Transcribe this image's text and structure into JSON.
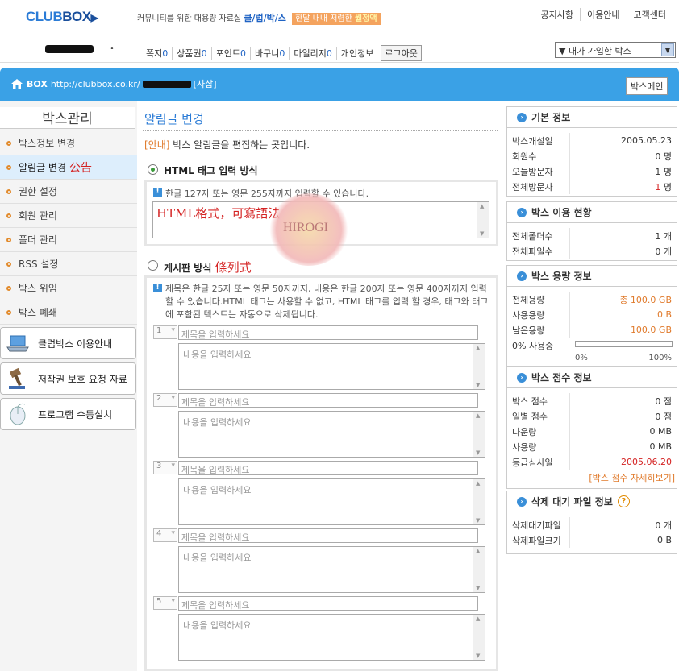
{
  "header": {
    "logo_main": "CLUB",
    "logo_box": "BOX",
    "tagline": "커뮤니티를 위한 대용량 자료실",
    "tagline_brand": "클/럽/박/스",
    "tagline_badge_prefix": "한달 내내 저렴한",
    "tagline_badge_emph": "월정액",
    "links": [
      "공지사항",
      "이용안내",
      "고객센터"
    ]
  },
  "userbar": {
    "items": [
      {
        "label": "쪽지",
        "count": "0"
      },
      {
        "label": "상품권",
        "count": "0"
      },
      {
        "label": "포인트",
        "count": "0"
      },
      {
        "label": "바구니",
        "count": "0"
      },
      {
        "label": "마일리지",
        "count": "0"
      },
      {
        "label": "개인정보",
        "count": ""
      }
    ],
    "logout": "로그아웃",
    "box_select": "▼ 내가 가입한 박스"
  },
  "band": {
    "box_label": "BOX",
    "url": "http://clubbox.co.kr/",
    "tag": "[사삽]",
    "box_main_button": "박스메인"
  },
  "sidebar": {
    "title": "박스관리",
    "items": [
      {
        "label": "박스정보 변경",
        "note": ""
      },
      {
        "label": "알림글 변경",
        "note": "公告"
      },
      {
        "label": "권한 설정",
        "note": ""
      },
      {
        "label": "회원 관리",
        "note": ""
      },
      {
        "label": "폴더 관리",
        "note": ""
      },
      {
        "label": "RSS 설정",
        "note": ""
      },
      {
        "label": "박스 위임",
        "note": ""
      },
      {
        "label": "박스 폐쇄",
        "note": ""
      }
    ],
    "buttons": [
      {
        "label": "클럽박스 이용안내",
        "icon": "laptop-icon"
      },
      {
        "label": "저작권 보호 요청 자료",
        "icon": "gavel-icon"
      },
      {
        "label": "프로그램 수동설치",
        "icon": "mouse-icon"
      }
    ]
  },
  "main": {
    "title": "알림글 변경",
    "notice_tag": "[안내]",
    "notice_text": "박스 알림글을 편집하는 곳입니다.",
    "html_mode": {
      "label": "HTML 태그 입력 방식",
      "info": "한글 127자 또는 영문 255자까지 입력할 수 있습니다.",
      "textarea_value": "HTML格式，可寫語法"
    },
    "board_mode": {
      "label": "게시판 방식",
      "note": "條列式",
      "info": "제목은 한글 25자 또는 영문 50자까지, 내용은 한글 200자 또는 영문 400자까지 입력할 수 있습니다.HTML 태그는 사용할 수 없고, HTML 태그를 입력 할 경우, 태그와 태그에 포함된 텍스트는 자동으로 삭제됩니다.",
      "rows": [
        {
          "num": "1",
          "title_placeholder": "제목을 입력하세요",
          "content_placeholder": "내용을 입력하세요"
        },
        {
          "num": "2",
          "title_placeholder": "제목을 입력하세요",
          "content_placeholder": "내용을 입력하세요"
        },
        {
          "num": "3",
          "title_placeholder": "제목을 입력하세요",
          "content_placeholder": "내용을 입력하세요"
        },
        {
          "num": "4",
          "title_placeholder": "제목을 입력하세요",
          "content_placeholder": "내용을 입력하세요"
        },
        {
          "num": "5",
          "title_placeholder": "제목을 입력하세요",
          "content_placeholder": "내용을 입력하세요"
        }
      ]
    },
    "watermark": "HIROGI"
  },
  "right": {
    "basic": {
      "title": "기본 정보",
      "rows": [
        {
          "k": "박스개설일",
          "v": "2005.05.23"
        },
        {
          "k": "회원수",
          "v": "0 명"
        },
        {
          "k": "오늘방문자",
          "v": "1 명"
        },
        {
          "k": "전체방문자",
          "v_red": "1",
          "v_unit": " 명"
        }
      ]
    },
    "usage": {
      "title": "박스 이용 현황",
      "rows": [
        {
          "k": "전체폴더수",
          "v": "1 개"
        },
        {
          "k": "전체파일수",
          "v": "0 개"
        }
      ]
    },
    "capacity": {
      "title": "박스 용량 정보",
      "rows": [
        {
          "k": "전체용량",
          "v": "총 100.0 GB"
        },
        {
          "k": "사용용량",
          "v": "0 B"
        },
        {
          "k": "남은용량",
          "v": "100.0 GB"
        }
      ],
      "usage_label": "0% 사용중",
      "usage_fraction": 0,
      "bar_min": "0%",
      "bar_max": "100%"
    },
    "score": {
      "title": "박스 점수 정보",
      "rows": [
        {
          "k": "박스 점수",
          "v": "0 점"
        },
        {
          "k": "일별 점수",
          "v": "0 점"
        },
        {
          "k": "다운량",
          "v": "0 MB"
        },
        {
          "k": "사용량",
          "v": "0 MB"
        },
        {
          "k": "등급심사일",
          "v": "2005.06.20"
        }
      ],
      "detail_link": "[박스 점수 자세히보기]"
    },
    "pending": {
      "title": "삭제 대기 파일 정보",
      "help": "?",
      "rows": [
        {
          "k": "삭제대기파일",
          "v": "0 개"
        },
        {
          "k": "삭제파일크기",
          "v": "0 B"
        }
      ]
    }
  }
}
